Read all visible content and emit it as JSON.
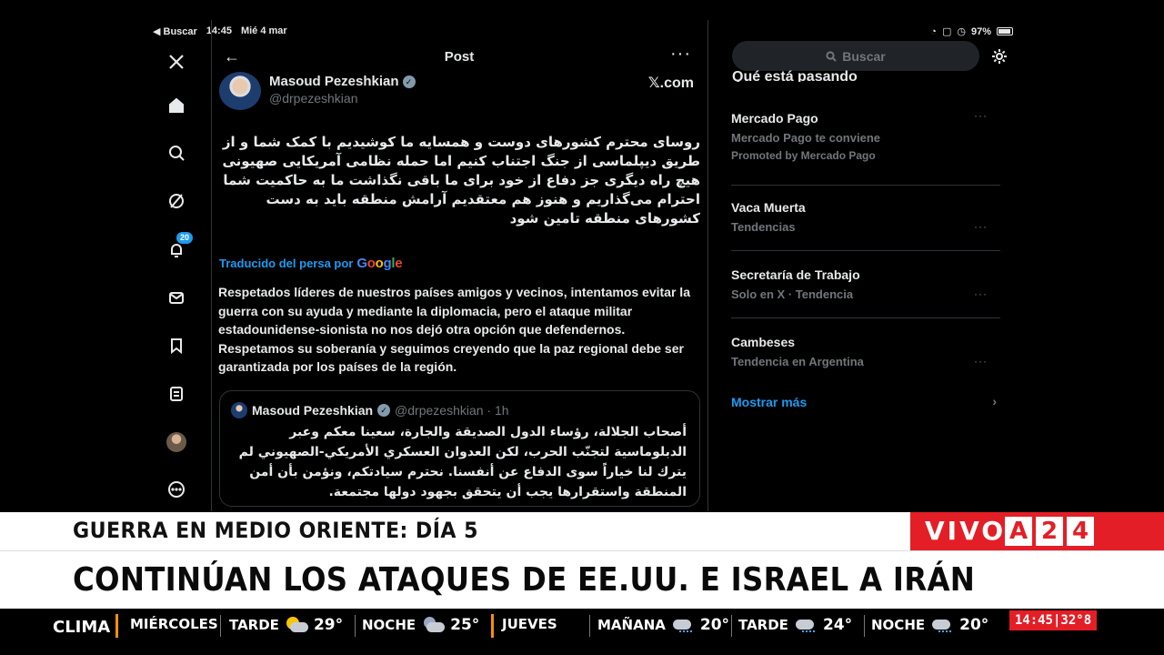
{
  "status_bar": {
    "back_app": "◀ Buscar",
    "time": "14:45",
    "date": "Mié 4 mar",
    "battery": "97%"
  },
  "nav": {
    "notifications_badge": "20"
  },
  "post": {
    "header_title": "Post",
    "author_name": "Masoud Pezeshkian",
    "author_handle": "@drpezeshkian",
    "source": "𝕏.com",
    "original_text": "روسای محترم کشورهای دوست و همسایه ما کوشیدیم با کمک شما و از طریق دیپلماسی از جنگ اجتناب کنیم اما حمله نظامی آمریکایی صهیونی هیچ راه دیگری جز دفاع از خود برای ما باقی نگذاشت ما به حاکمیت شما احترام می‌گذاریم و هنوز هم معتقدیم آرامش منطقه باید به دست کشورهای منطقه تامین شود",
    "translated_label": "Traducido del persa por",
    "translation": "Respetados líderes de nuestros países amigos y vecinos, intentamos evitar la guerra con su ayuda y mediante la diplomacia, pero el ataque militar estadounidense-sionista no nos dejó otra opción que defendernos. Respetamos su soberanía y seguimos creyendo que la paz regional debe ser garantizada por los países de la región.",
    "quote": {
      "author_name": "Masoud Pezeshkian",
      "author_handle": "@drpezeshkian · 1h",
      "text": "أصحاب الجلالة، رؤساء الدول الصديقة والجارة، سعينا معكم وعبر الدبلوماسية لتجنّب الحرب، لكن العدوان العسكري الأمريكي-الصهيوني لم يترك لنا خياراً سوى الدفاع عن أنفسنا. نحترم سيادتكم، ونؤمن بأن أمن المنطقة واستقرارها يجب أن يتحقق بجهود دولها مجتمعة."
    }
  },
  "sidebar": {
    "search_placeholder": "Buscar",
    "heading": "Qué está pasando",
    "trends": [
      {
        "title": "Mercado Pago",
        "subtitle": "Mercado Pago te conviene",
        "promo": "Promoted by Mercado Pago"
      },
      {
        "title": "Vaca Muerta",
        "subtitle": "Tendencias"
      },
      {
        "title": "Secretaría de Trabajo",
        "subtitle": "Solo en X · Tendencia"
      },
      {
        "title": "Cambeses",
        "subtitle": "Tendencia en Argentina"
      }
    ],
    "show_more": "Mostrar más"
  },
  "broadcast": {
    "kicker": "GUERRA EN MEDIO ORIENTE: DÍA 5",
    "headline": "CONTINÚAN LOS ATAQUES DE EE.UU. E ISRAEL A IRÁN",
    "live_label": "VIVO",
    "channel_chars": [
      "A",
      "2",
      "4"
    ],
    "ticker": {
      "label": "CLIMA",
      "day1": "MIÉRCOLES",
      "d1_tarde_label": "TARDE",
      "d1_tarde_temp": "29°",
      "d1_noche_label": "NOCHE",
      "d1_noche_temp": "25°",
      "day2": "JUEVES",
      "d2_manana_label": "MAÑANA",
      "d2_manana_temp": "20°",
      "d2_tarde_label": "TARDE",
      "d2_tarde_temp": "24°",
      "d2_noche_label": "NOCHE",
      "d2_noche_temp": "20°"
    },
    "clock": "14:45|32°8"
  },
  "colors": {
    "accent": "#1d9bf0",
    "channel_red": "#e41e26",
    "ticker_orange": "#f39200"
  }
}
